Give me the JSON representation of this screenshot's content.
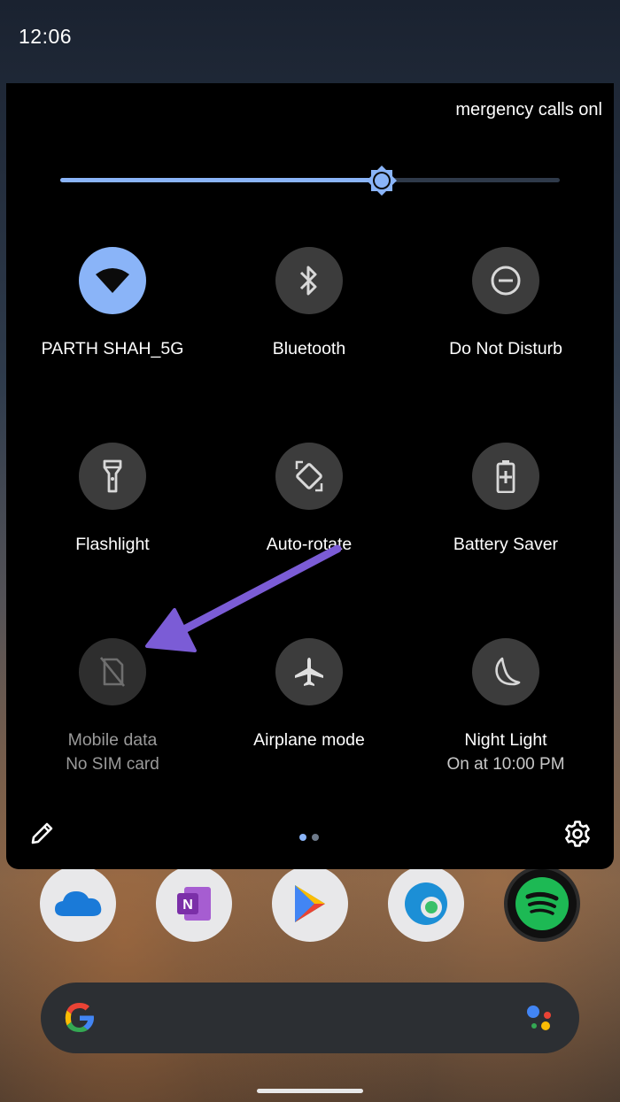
{
  "status_bar": {
    "time": "12:06"
  },
  "carrier": {
    "text": "mergency calls onl"
  },
  "brightness": {
    "level": 0.645,
    "accent": "#8ab4f8"
  },
  "tiles": [
    {
      "label": "PARTH SHAH_5G",
      "sub": "",
      "icon": "wifi-icon",
      "state": "on"
    },
    {
      "label": "Bluetooth",
      "sub": "",
      "icon": "bluetooth-icon",
      "state": "off"
    },
    {
      "label": "Do Not Disturb",
      "sub": "",
      "icon": "do-not-disturb-icon",
      "state": "off"
    },
    {
      "label": "Flashlight",
      "sub": "",
      "icon": "flashlight-icon",
      "state": "off"
    },
    {
      "label": "Auto-rotate",
      "sub": "",
      "icon": "auto-rotate-icon",
      "state": "off"
    },
    {
      "label": "Battery Saver",
      "sub": "",
      "icon": "battery-saver-icon",
      "state": "off"
    },
    {
      "label": "Mobile data",
      "sub": "No SIM card",
      "icon": "no-sim-icon",
      "state": "disabled"
    },
    {
      "label": "Airplane mode",
      "sub": "",
      "icon": "airplane-icon",
      "state": "off"
    },
    {
      "label": "Night Light",
      "sub": "On at 10:00 PM",
      "icon": "night-light-icon",
      "state": "off"
    }
  ],
  "footer": {
    "edit_icon": "pencil-icon",
    "settings_icon": "gear-icon",
    "pages": {
      "current": 1,
      "total": 2
    }
  },
  "dock_apps": [
    "OneDrive",
    "OneNote",
    "Play Store",
    "Edge",
    "Spotify"
  ],
  "search_bar": {
    "logo": "google-g-icon",
    "assistant": "assistant-icon"
  },
  "annotation": {
    "arrow_color": "#7b5cd6"
  }
}
